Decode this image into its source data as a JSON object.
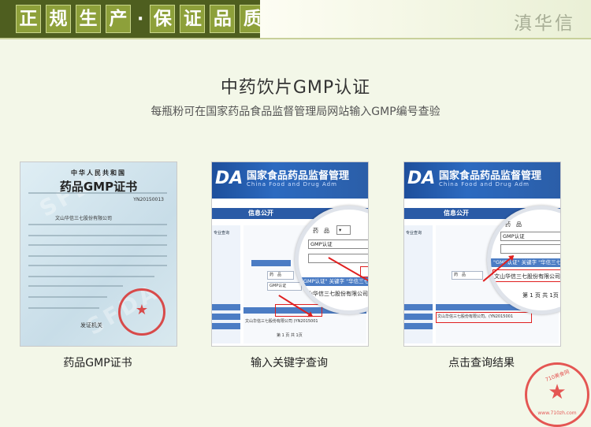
{
  "banner": {
    "chars_left": [
      "正",
      "规",
      "生",
      "产"
    ],
    "separator": "·",
    "chars_right": [
      "保",
      "证",
      "品",
      "质"
    ],
    "brand": "滇华信"
  },
  "section": {
    "title": "中药饮片GMP认证",
    "subtitle": "每瓶粉可在国家药品食品监督管理局网站输入GMP编号查验"
  },
  "cards": [
    {
      "caption": "药品GMP证书",
      "cert": {
        "header_cn": "中华人民共和国",
        "title": "药品GMP证书",
        "code": "YN20150013",
        "company": "文山华信三七股份有限公司",
        "issued": "发证机关",
        "watermark": "SFDA"
      }
    },
    {
      "caption": "输入关键字查询",
      "site": {
        "logo": "DA",
        "name": "国家食品药品监督管理",
        "name_en": "China Food and Drug Adm",
        "nav": "信息公开",
        "crumb": "专业查询",
        "search_label": "药　品",
        "select_value": "GMP认证",
        "result_text": "\"GMP认证\" 关键字 \"华信三七\" 的内容",
        "result_item": "文山华信三七股份有限公司 (YN2015001",
        "page_info": "第 1 页 共 1页"
      }
    },
    {
      "caption": "点击查询结果",
      "site": {
        "logo": "DA",
        "name": "国家食品药品监督管理",
        "name_en": "China Food and Drug Adm",
        "nav1": "信息公开",
        "nav2": "专业查询",
        "search_label": "药　品",
        "select_value": "GMP认证",
        "result_text": "\"GMP认证\" 关键字 \"华信三七\" 的内容",
        "result_item": "文山华信三七股份有限公司。(YN2015001",
        "page_info": "第 1 页 共 1页"
      }
    }
  ],
  "stamp": {
    "ring_text": "710美食网",
    "url": "www.710zh.com"
  },
  "colors": {
    "banner_dark": "#4e5e1f",
    "chip": "#8da03a",
    "background": "#f3f7e8",
    "site_blue": "#2c6ac0",
    "highlight_red": "#e02020"
  }
}
